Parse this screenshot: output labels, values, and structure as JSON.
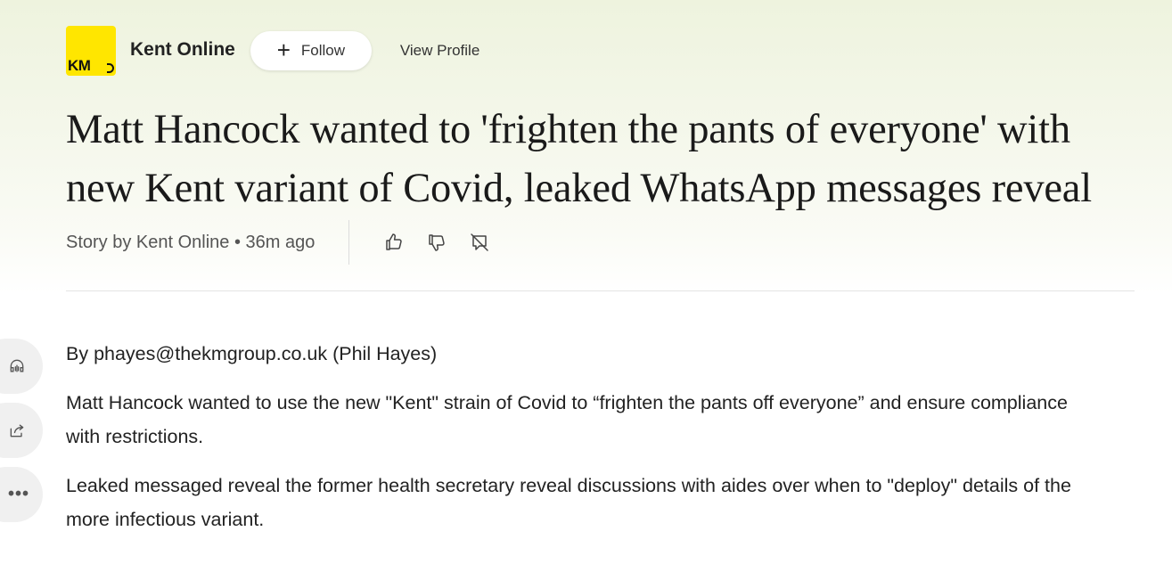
{
  "publisher": {
    "logo_text": "KM",
    "name": "Kent Online",
    "follow_label": "Follow",
    "view_profile_label": "View Profile"
  },
  "article": {
    "headline": "Matt Hancock wanted to 'frighten the pants of everyone' with new Kent variant of Covid, leaked WhatsApp messages reveal",
    "byline": "Story by Kent Online • 36m ago",
    "reactions": [
      "thumbs-up-icon",
      "thumbs-down-icon",
      "comments-off-icon"
    ],
    "paragraphs": [
      "By phayes@thekmgroup.co.uk (Phil Hayes)",
      "Matt Hancock wanted to use the new \"Kent\" strain of Covid to “frighten the pants off everyone” and ensure compliance with restrictions.",
      "Leaked messaged reveal the former health secretary reveal discussions with aides over when to \"deploy\" details of the more infectious variant."
    ]
  },
  "side_tools": [
    "headphones-icon",
    "share-icon",
    "more-icon"
  ],
  "colors": {
    "logo_yellow": "#ffe600",
    "header_tint": "#eef3de"
  }
}
